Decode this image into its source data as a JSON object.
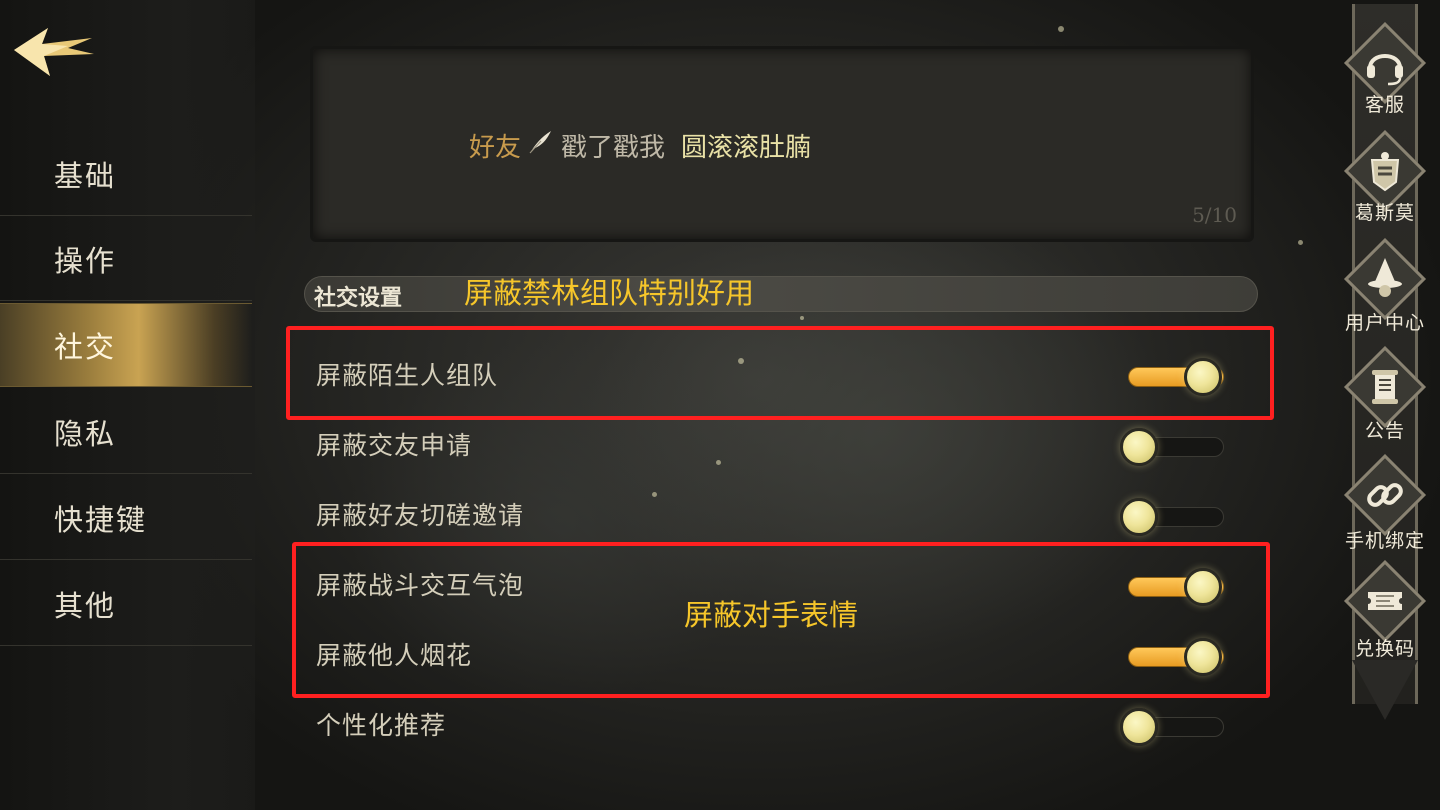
{
  "sidebar": {
    "items": [
      {
        "label": "基础",
        "active": false
      },
      {
        "label": "操作",
        "active": false
      },
      {
        "label": "社交",
        "active": true
      },
      {
        "label": "隐私",
        "active": false
      },
      {
        "label": "快捷键",
        "active": false
      },
      {
        "label": "其他",
        "active": false
      }
    ]
  },
  "message": {
    "tag": "好友",
    "action": "戳了戳我",
    "name": "圆滚滚肚腩",
    "counter": "5/10"
  },
  "section": {
    "title": "社交设置"
  },
  "annotations": {
    "forest_team": "屏蔽禁林组队特别好用",
    "opponent_emote": "屏蔽对手表情"
  },
  "settings": [
    {
      "label": "屏蔽陌生人组队",
      "enabled": true
    },
    {
      "label": "屏蔽交友申请",
      "enabled": false
    },
    {
      "label": "屏蔽好友切磋邀请",
      "enabled": false
    },
    {
      "label": "屏蔽战斗交互气泡",
      "enabled": true
    },
    {
      "label": "屏蔽他人烟花",
      "enabled": true
    },
    {
      "label": "个性化推荐",
      "enabled": false
    }
  ],
  "right_menu": [
    {
      "label": "客服",
      "icon": "headset-icon"
    },
    {
      "label": "葛斯莫",
      "icon": "gobstones-crest-icon"
    },
    {
      "label": "用户中心",
      "icon": "wizard-hat-icon"
    },
    {
      "label": "公告",
      "icon": "scroll-icon"
    },
    {
      "label": "手机绑定",
      "icon": "chain-link-icon"
    },
    {
      "label": "兑换码",
      "icon": "ticket-icon"
    }
  ],
  "colors": {
    "accent_gold": "#e79b22",
    "knob": "#efe59b",
    "annotation": "#f6c62a",
    "highlight_box": "#ff2020"
  }
}
